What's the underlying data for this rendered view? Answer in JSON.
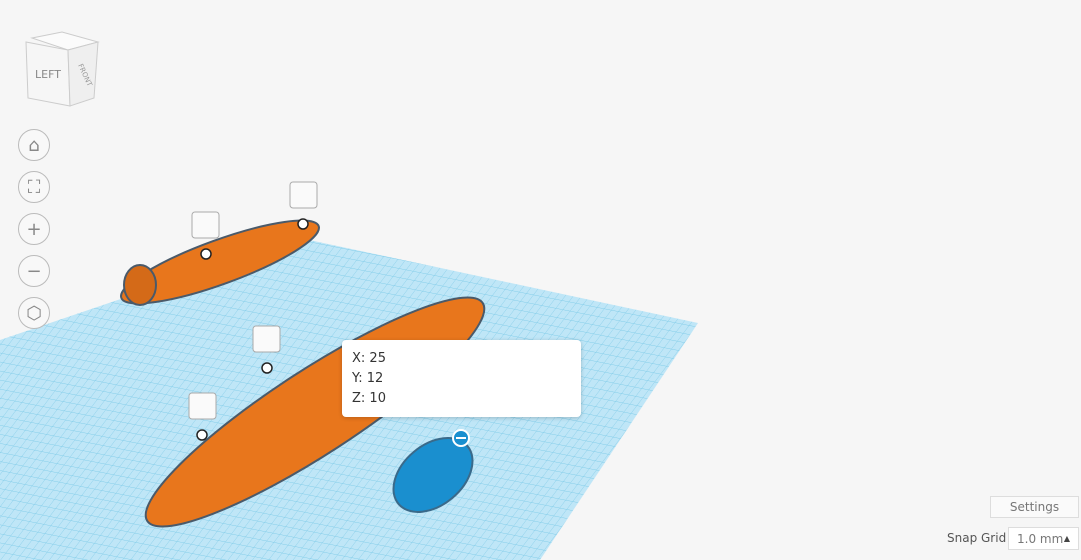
{
  "view_cube": {
    "left_label": "LEFT",
    "front_label": "FRONT"
  },
  "nav_buttons": [
    {
      "name": "home-view",
      "icon": "⌂"
    },
    {
      "name": "fit-view",
      "icon": "⛶"
    },
    {
      "name": "zoom-in",
      "icon": "+"
    },
    {
      "name": "zoom-out",
      "icon": "−"
    },
    {
      "name": "perspective",
      "icon": "⬡"
    }
  ],
  "tooltip": {
    "x": "X: 25",
    "y": "Y: 12",
    "z": "Z: 10"
  },
  "settings_label": "Settings",
  "snap_grid": {
    "label": "Snap Grid",
    "value": "1.0 mm"
  },
  "colors": {
    "orange": "#e8761c",
    "blue": "#1a8fcf",
    "grid": "#a8dcf2"
  }
}
